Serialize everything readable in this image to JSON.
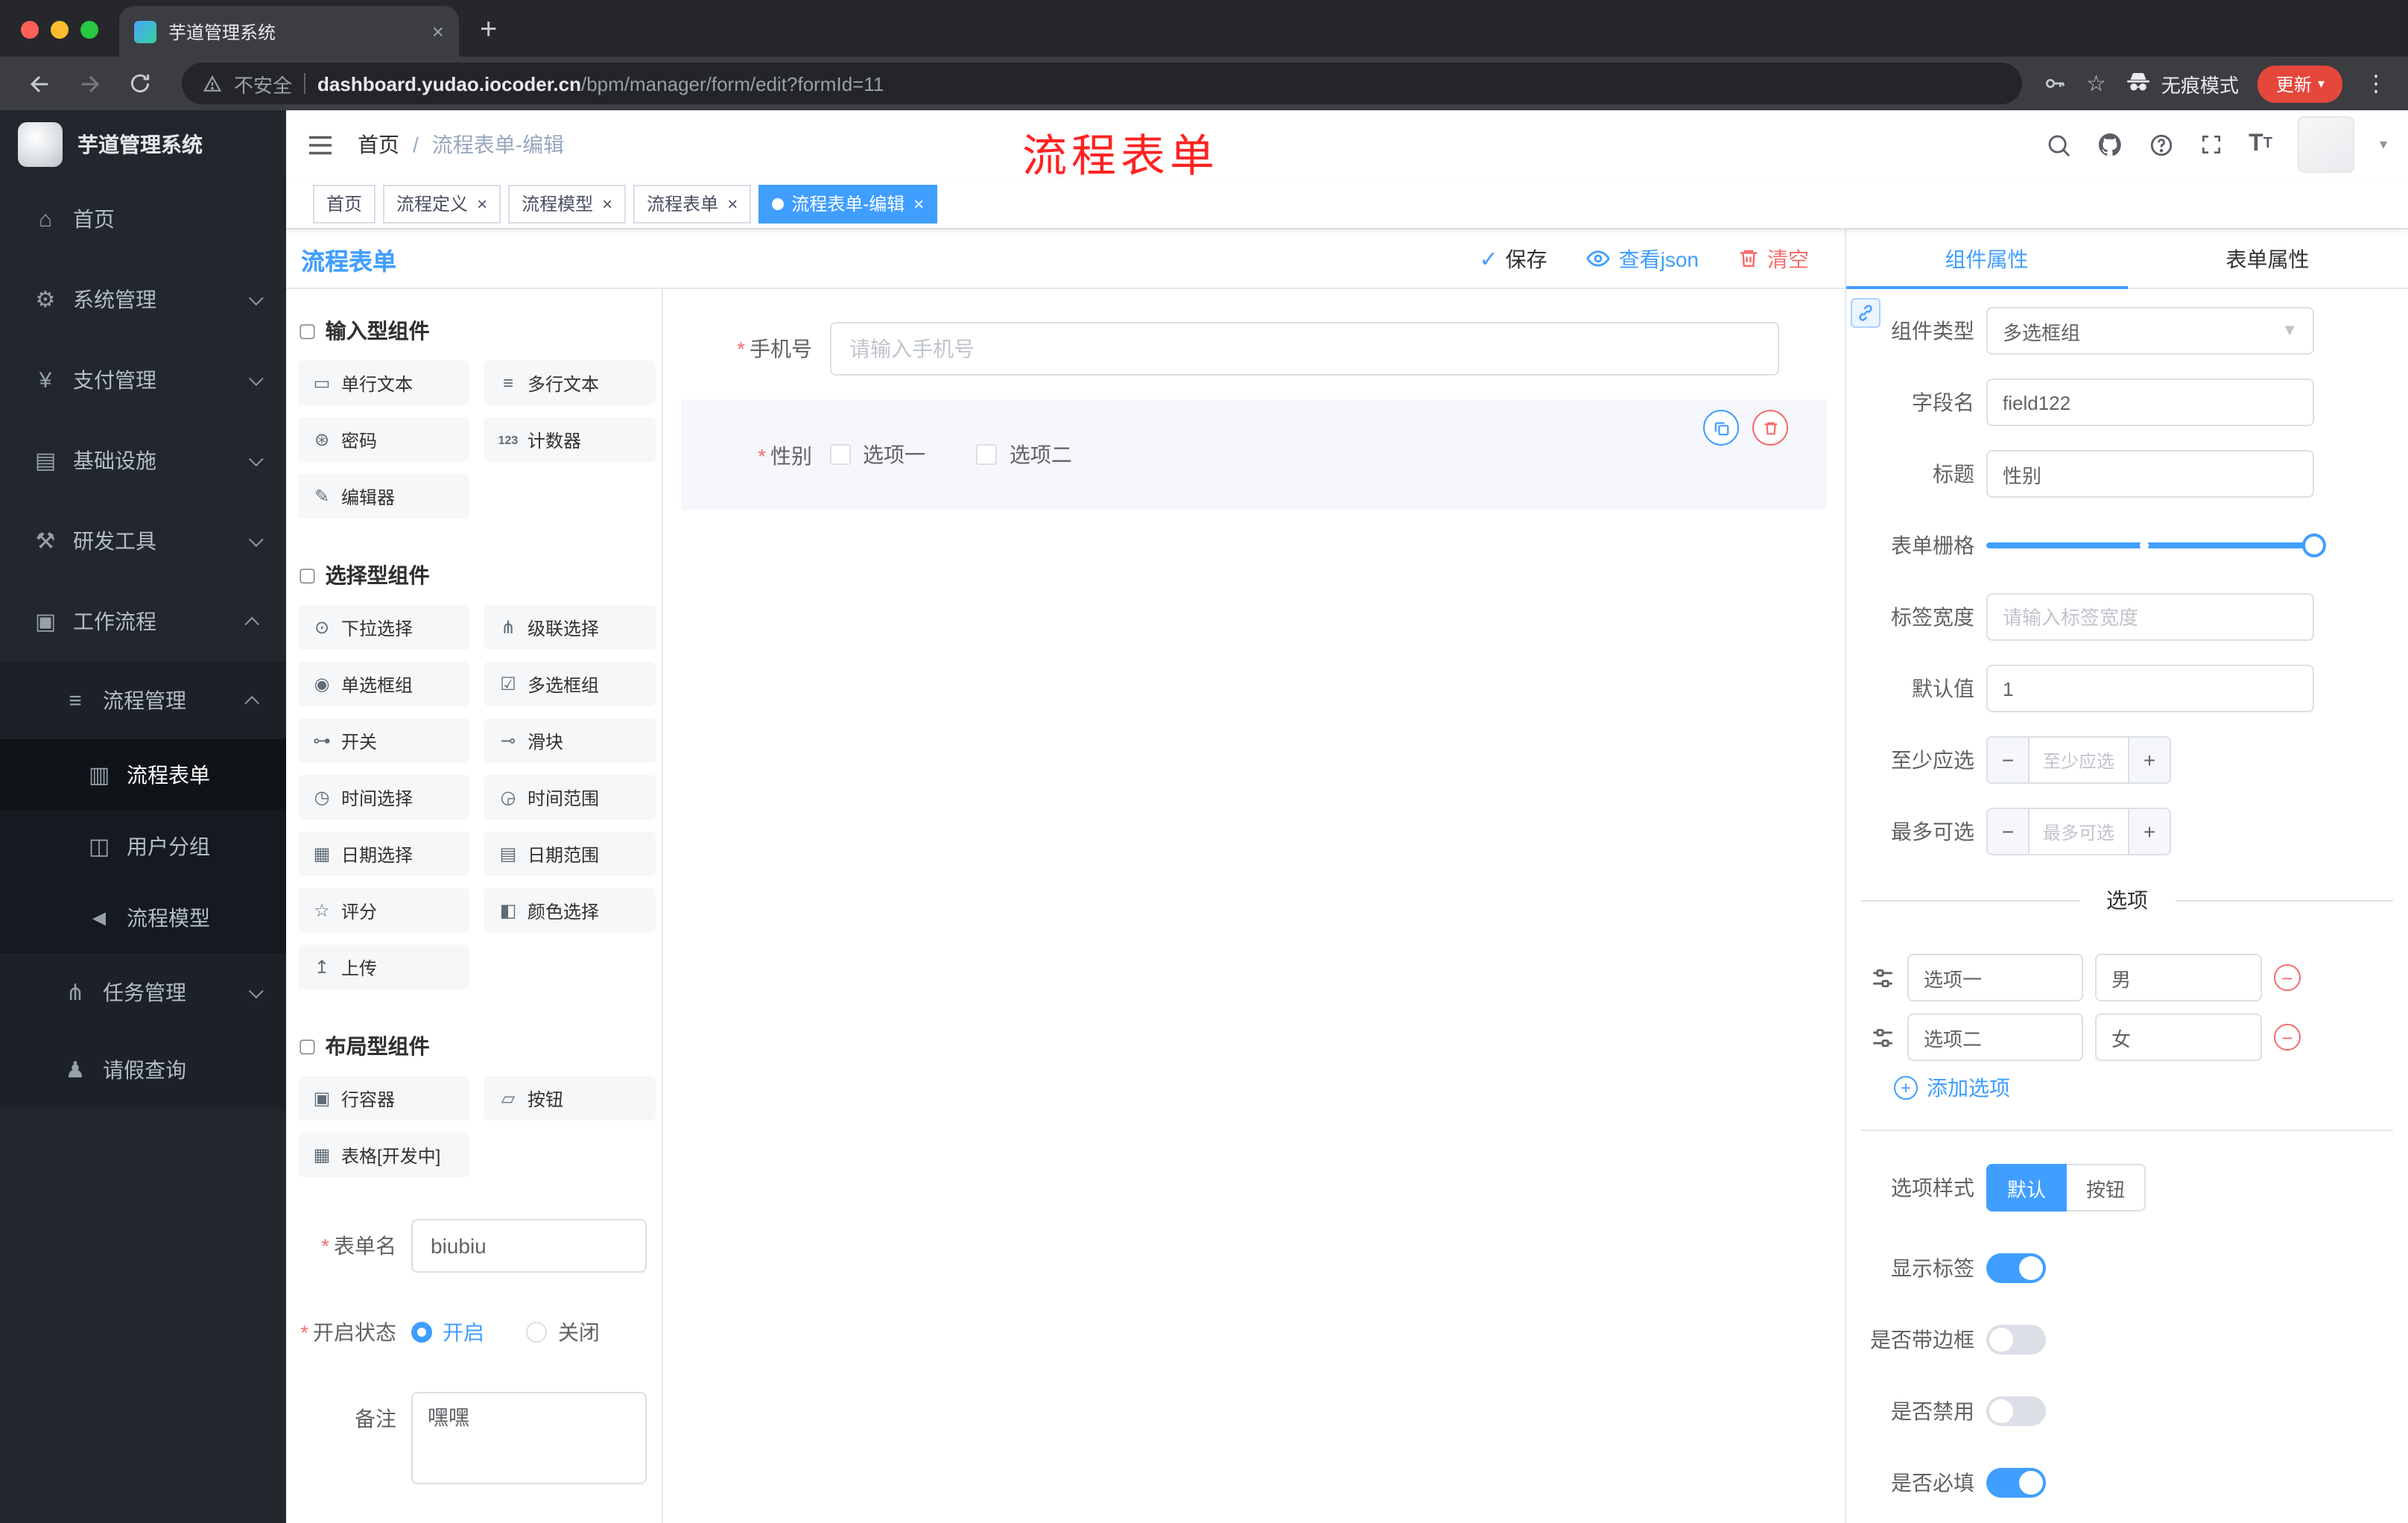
{
  "browser": {
    "tab_title": "芋道管理系统",
    "security_label": "不安全",
    "url_domain": "dashboard.yudao.iocoder.cn",
    "url_path": "/bpm/manager/form/edit?formId=11",
    "incognito_label": "无痕模式",
    "update_label": "更新"
  },
  "sidebar": {
    "logo_title": "芋道管理系统",
    "items": [
      {
        "label": "首页",
        "icon": "dashboard-icon"
      },
      {
        "label": "系统管理",
        "icon": "gear-icon"
      },
      {
        "label": "支付管理",
        "icon": "payment-icon"
      },
      {
        "label": "基础设施",
        "icon": "infrastructure-icon"
      },
      {
        "label": "研发工具",
        "icon": "dev-tools-icon"
      },
      {
        "label": "工作流程",
        "icon": "workflow-icon"
      },
      {
        "label": "流程管理",
        "icon": "process-management-icon"
      },
      {
        "label": "流程表单",
        "icon": "process-form-icon"
      },
      {
        "label": "用户分组",
        "icon": "user-group-icon"
      },
      {
        "label": "流程模型",
        "icon": "process-model-icon"
      },
      {
        "label": "任务管理",
        "icon": "task-management-icon"
      },
      {
        "label": "请假查询",
        "icon": "leave-query-icon"
      }
    ]
  },
  "header": {
    "breadcrumb": [
      "首页",
      "流程表单-编辑"
    ],
    "breadcrumb_separator": "/",
    "annotation": "流程表单"
  },
  "tagbar": {
    "tabs": [
      {
        "label": "首页",
        "closable": false,
        "active": false
      },
      {
        "label": "流程定义",
        "closable": true,
        "active": false
      },
      {
        "label": "流程模型",
        "closable": true,
        "active": false
      },
      {
        "label": "流程表单",
        "closable": true,
        "active": false
      },
      {
        "label": "流程表单-编辑",
        "closable": true,
        "active": true
      }
    ]
  },
  "designer": {
    "title": "流程表单",
    "actions": {
      "save": "保存",
      "view_json": "查看json",
      "clear": "清空"
    },
    "palette": {
      "sections": [
        {
          "title": "输入型组件",
          "items": [
            "单行文本",
            "多行文本",
            "密码",
            "计数器",
            "编辑器"
          ]
        },
        {
          "title": "选择型组件",
          "items": [
            "下拉选择",
            "级联选择",
            "单选框组",
            "多选框组",
            "开关",
            "滑块",
            "时间选择",
            "时间范围",
            "日期选择",
            "日期范围",
            "评分",
            "颜色选择",
            "上传"
          ]
        },
        {
          "title": "布局型组件",
          "items": [
            "行容器",
            "按钮",
            "表格[开发中]"
          ]
        }
      ]
    },
    "meta": {
      "form_name_label": "表单名",
      "form_name_value": "biubiu",
      "status_label": "开启状态",
      "status_on": "开启",
      "status_off": "关闭",
      "status_selected": "开启",
      "remark_label": "备注",
      "remark_value": "嘿嘿"
    },
    "canvas": {
      "phone_label": "手机号",
      "phone_placeholder": "请输入手机号",
      "gender_label": "性别",
      "gender_opt1": "选项一",
      "gender_opt2": "选项二"
    }
  },
  "properties": {
    "tab_component": "组件属性",
    "tab_form": "表单属性",
    "component_type_label": "组件类型",
    "component_type_value": "多选框组",
    "field_name_label": "字段名",
    "field_name_value": "field122",
    "title_label": "标题",
    "title_value": "性别",
    "grid_label": "表单栅格",
    "label_width_label": "标签宽度",
    "label_width_placeholder": "请输入标签宽度",
    "default_label": "默认值",
    "default_value": "1",
    "min_label": "至少应选",
    "min_placeholder": "至少应选",
    "max_label": "最多可选",
    "max_placeholder": "最多可选",
    "options_divider": "选项",
    "options": [
      {
        "name": "选项一",
        "value": "男"
      },
      {
        "name": "选项二",
        "value": "女"
      }
    ],
    "add_option": "添加选项",
    "style_label": "选项样式",
    "style_default": "默认",
    "style_button": "按钮",
    "style_selected": "默认",
    "show_label": "显示标签",
    "show_label_on": true,
    "border_label": "是否带边框",
    "border_on": false,
    "disabled_label": "是否禁用",
    "disabled_on": false,
    "required_label": "是否必填",
    "required_on": true
  },
  "colors": {
    "primary": "#409EFF",
    "danger": "#F56C6C",
    "sidebar_bg": "#21272D",
    "tag_active": "#409EFF"
  }
}
